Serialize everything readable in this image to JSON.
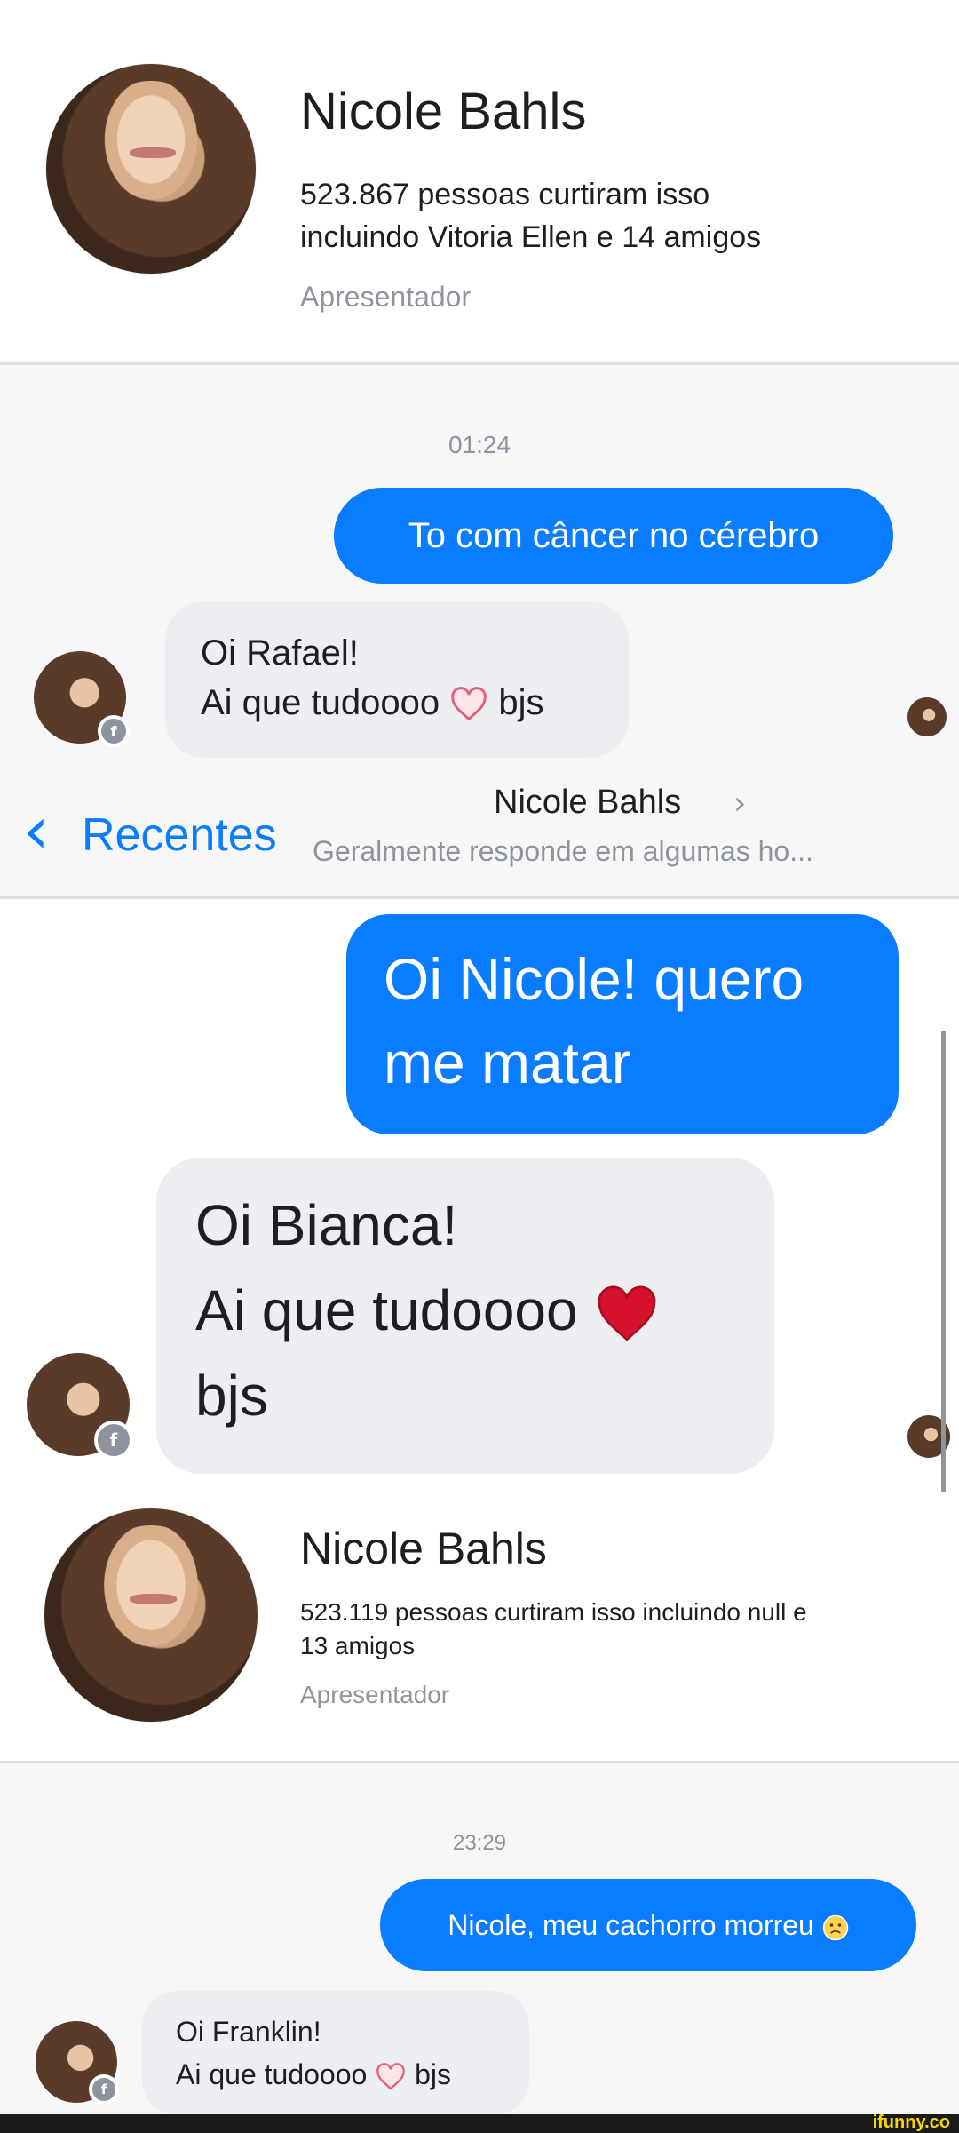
{
  "section1": {
    "header": {
      "name": "Nicole Bahls",
      "likes_line1": "523.867 pessoas curtiram isso",
      "likes_line2": "incluindo Vitoria Ellen e 14 amigos",
      "category": "Apresentador"
    },
    "timestamp": "01:24",
    "outgoing": "To com câncer no cérebro",
    "incoming_line1": "Oi Rafael!",
    "incoming_line2_a": "Ai que tudoooo",
    "incoming_line2_b": "bjs"
  },
  "nav": {
    "back_label": "Recentes",
    "title": "Nicole Bahls",
    "subtitle": "Geralmente responde em algumas ho..."
  },
  "section2": {
    "outgoing_line1": "Oi Nicole! quero",
    "outgoing_line2": "me matar",
    "incoming_line1": "Oi Bianca!",
    "incoming_line2": "Ai que tudoooo",
    "incoming_line3": "bjs"
  },
  "section3": {
    "header": {
      "name": "Nicole Bahls",
      "likes_line1": "523.119 pessoas curtiram isso incluindo null e",
      "likes_line2": "13 amigos",
      "category": "Apresentador"
    },
    "timestamp": "23:29",
    "outgoing": "Nicole, meu cachorro morreu",
    "incoming_line1": "Oi Franklin!",
    "incoming_line2_a": "Ai que tudoooo",
    "incoming_line2_b": "bjs"
  },
  "watermark": "ifunny.co",
  "colors": {
    "accent": "#0a7cff",
    "incoming_bubble": "#eceef1",
    "heart_outline": "#e0607e",
    "heart_filled": "#d5112c"
  },
  "icons": [
    "back-chevron-icon",
    "chevron-right-icon",
    "messenger-badge-icon",
    "heart-outline-icon",
    "heart-filled-icon",
    "sad-emoji-icon"
  ]
}
